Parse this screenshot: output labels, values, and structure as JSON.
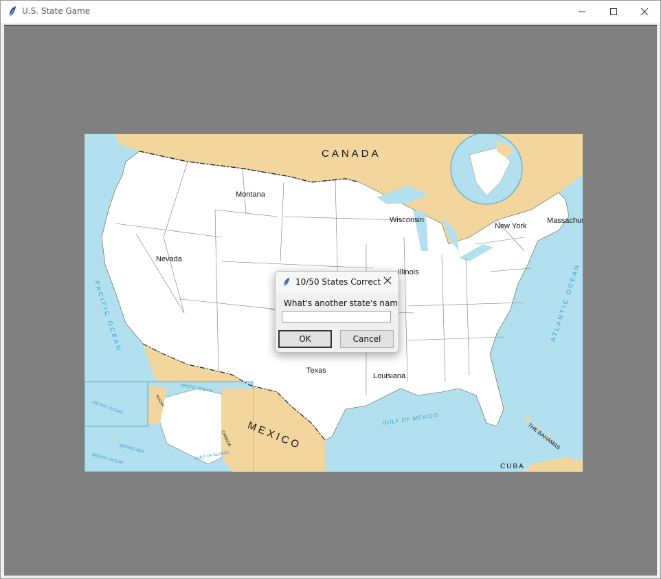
{
  "window": {
    "title": "U.S. State Game",
    "controls": {
      "minimize": "minimize-icon",
      "maximize": "maximize-icon",
      "close": "close-icon"
    }
  },
  "map": {
    "region_labels": {
      "canada": "CANADA",
      "mexico": "MEXICO",
      "pacific": "PACIFIC OCEAN",
      "atlantic": "ATLANTIC OCEAN",
      "gulf": "GULF OF MEXICO",
      "cuba": "CUBA",
      "bahamas": "THE BAHAMAS",
      "canada_small": "CANADA",
      "pacific_inset": "PACIFIC OCEAN",
      "pacific_inset2": "PACIFIC OCEAN",
      "arctic": "ARCTIC OCEAN",
      "bering": "BERING SEA",
      "alaska_gulf": "GULF OF ALASKA",
      "russia": "RUSSIA"
    },
    "guessed_states": [
      {
        "name": "Montana"
      },
      {
        "name": "Nevada"
      },
      {
        "name": "Wisconsin"
      },
      {
        "name": "Illinois"
      },
      {
        "name": "New York"
      },
      {
        "name": "Massachusetts"
      },
      {
        "name": "Texas"
      },
      {
        "name": "Louisiana"
      }
    ],
    "colors": {
      "water": "#b3e0ee",
      "land_foreign": "#f2d69e",
      "land_us": "#ffffff",
      "water_text": "#2a9fd0"
    }
  },
  "dialog": {
    "title": "10/50 States Correct",
    "prompt": "What's another state's name?",
    "input_value": "",
    "ok_label": "OK",
    "cancel_label": "Cancel"
  }
}
